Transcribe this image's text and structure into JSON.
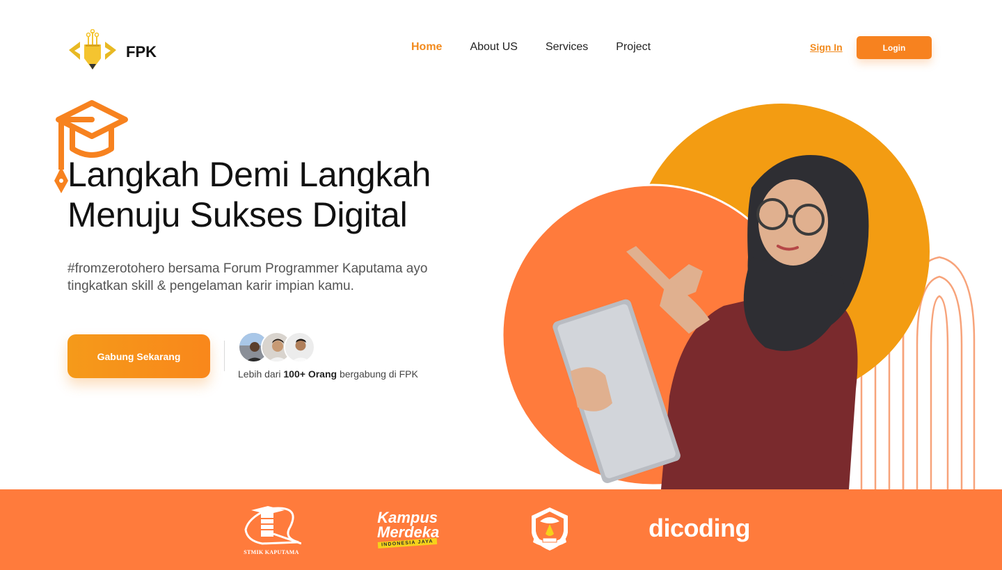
{
  "brand": {
    "name": "FPK"
  },
  "nav": {
    "items": [
      {
        "label": "Home",
        "active": true
      },
      {
        "label": "About US",
        "active": false
      },
      {
        "label": "Services",
        "active": false
      },
      {
        "label": "Project",
        "active": false
      }
    ],
    "signin_label": "Sign In",
    "login_label": "Login"
  },
  "hero": {
    "title_line1": "Langkah Demi Langkah",
    "title_line2": "Menuju Sukses Digital",
    "subtitle_line1": "#fromzerotohero bersama Forum Programmer Kaputama ayo",
    "subtitle_line2": "tingkatkan skill & pengelaman karir impian kamu.",
    "cta_label": "Gabung Sekarang",
    "joined_prefix": "Lebih dari",
    "joined_count": "100+ Orang",
    "joined_suffix": "bergabung di FPK"
  },
  "partners": {
    "stmik_caption": "STMIK KAPUTAMA",
    "kampus_word1": "Kampus",
    "kampus_word2": "Merdeka",
    "kampus_tag": "INDONESIA JAYA",
    "dicoding": "dicoding"
  },
  "colors": {
    "accent": "#f28a1d",
    "orange_circle": "#ff7b3c",
    "amber_circle": "#f39c12",
    "strip": "#ff7b3c"
  },
  "icons": {
    "logo": "code-pencil-logo",
    "hat": "graduation-cap-pen-icon",
    "tutwuri": "tut-wuri-handayani-emblem"
  }
}
